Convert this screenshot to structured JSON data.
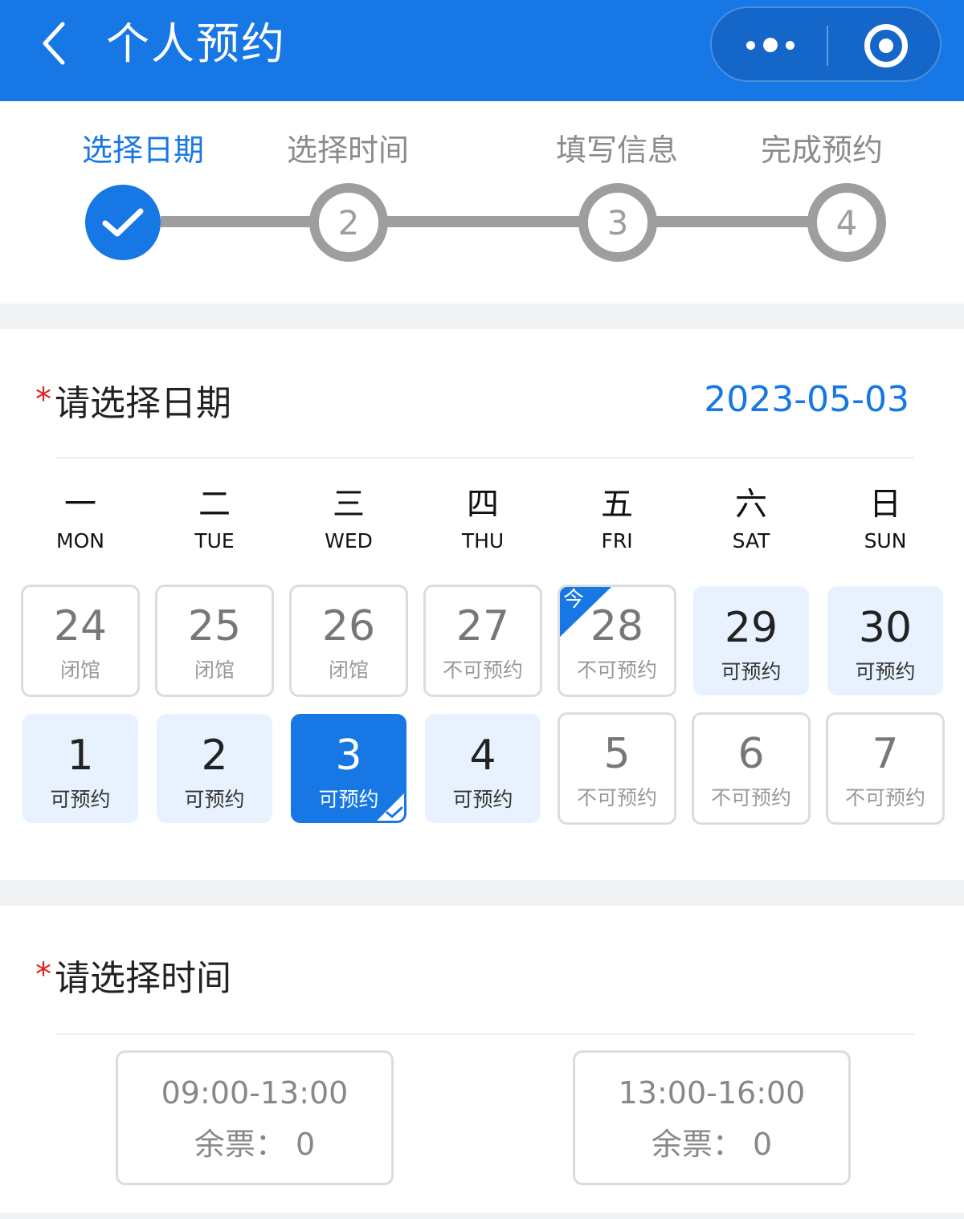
{
  "header": {
    "title": "个人预约",
    "back_icon": "chevron-left-icon",
    "more_icon": "more-dots-icon",
    "close_icon": "target-circle-icon",
    "bg_color": "#1677e5"
  },
  "steps": [
    {
      "label": "选择日期",
      "marker": "",
      "state": "done"
    },
    {
      "label": "选择时间",
      "marker": "2",
      "state": "pending"
    },
    {
      "label": "填写信息",
      "marker": "3",
      "state": "pending"
    },
    {
      "label": "完成预约",
      "marker": "4",
      "state": "pending"
    }
  ],
  "date_section": {
    "required_mark": "*",
    "title": "请选择日期",
    "selected_date": "2023-05-03",
    "weekdays": [
      {
        "cn": "一",
        "en": "MON"
      },
      {
        "cn": "二",
        "en": "TUE"
      },
      {
        "cn": "三",
        "en": "WED"
      },
      {
        "cn": "四",
        "en": "THU"
      },
      {
        "cn": "五",
        "en": "FRI"
      },
      {
        "cn": "六",
        "en": "SAT"
      },
      {
        "cn": "日",
        "en": "SUN"
      }
    ],
    "days": [
      {
        "num": "24",
        "status": "闭馆",
        "kind": "closed"
      },
      {
        "num": "25",
        "status": "闭馆",
        "kind": "closed"
      },
      {
        "num": "26",
        "status": "闭馆",
        "kind": "closed"
      },
      {
        "num": "27",
        "status": "不可预约",
        "kind": "unavail"
      },
      {
        "num": "28",
        "status": "不可预约",
        "kind": "unavail",
        "today": "今"
      },
      {
        "num": "29",
        "status": "可预约",
        "kind": "avail"
      },
      {
        "num": "30",
        "status": "可预约",
        "kind": "avail"
      },
      {
        "num": "1",
        "status": "可预约",
        "kind": "avail"
      },
      {
        "num": "2",
        "status": "可预约",
        "kind": "avail"
      },
      {
        "num": "3",
        "status": "可预约",
        "kind": "selected"
      },
      {
        "num": "4",
        "status": "可预约",
        "kind": "avail"
      },
      {
        "num": "5",
        "status": "不可预约",
        "kind": "unavail"
      },
      {
        "num": "6",
        "status": "不可预约",
        "kind": "unavail"
      },
      {
        "num": "7",
        "status": "不可预约",
        "kind": "unavail"
      }
    ]
  },
  "time_section": {
    "required_mark": "*",
    "title": "请选择时间",
    "slots": [
      {
        "range": "09:00-13:00",
        "tickets": "余票： 0"
      },
      {
        "range": "13:00-16:00",
        "tickets": "余票： 0"
      }
    ]
  }
}
